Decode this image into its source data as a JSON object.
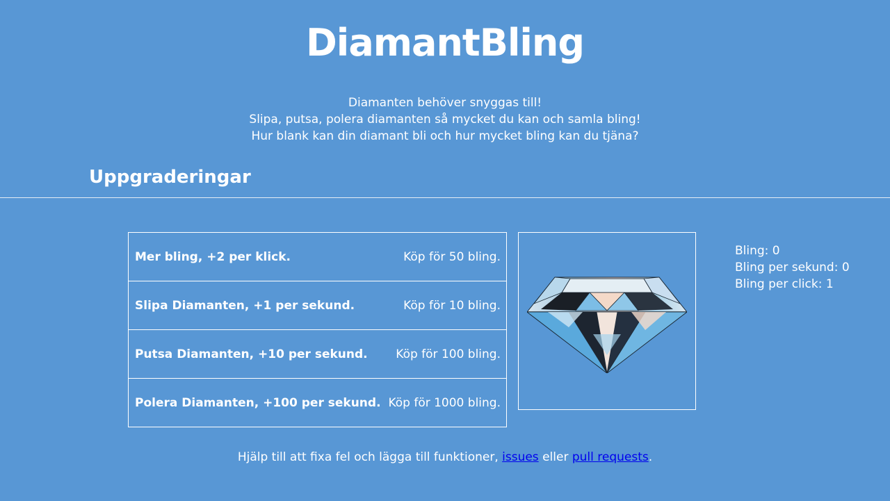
{
  "header": {
    "title": "DiamantBling",
    "intro": [
      "Diamanten behöver snyggas till!",
      "Slipa, putsa, polera diamanten så mycket du kan och samla bling!",
      "Hur blank kan din diamant bli och hur mycket bling kan du tjäna?"
    ]
  },
  "upgrades": {
    "heading": "Uppgraderingar",
    "items": [
      {
        "name": "Mer bling, +2 per klick.",
        "price": "Köp för 50 bling."
      },
      {
        "name": "Slipa Diamanten, +1 per sekund.",
        "price": "Köp för 10 bling."
      },
      {
        "name": "Putsa Diamanten, +10 per sekund.",
        "price": "Köp för 100 bling."
      },
      {
        "name": "Polera Diamanten, +100 per sekund.",
        "price": "Köp för 1000 bling."
      }
    ]
  },
  "diamond": {
    "icon": "diamond-icon"
  },
  "stats": {
    "bling": "Bling: 0",
    "bling_per_second": "Bling per sekund: 0",
    "bling_per_click": "Bling per click: 1"
  },
  "footer": {
    "text_before": "Hjälp till att fixa fel och lägga till funktioner, ",
    "link_issues": "issues",
    "text_middle": " eller ",
    "link_pull_requests": "pull requests",
    "text_after": "."
  },
  "colors": {
    "background": "#5897d5",
    "text": "#ffffff",
    "link": "#0000ee"
  }
}
